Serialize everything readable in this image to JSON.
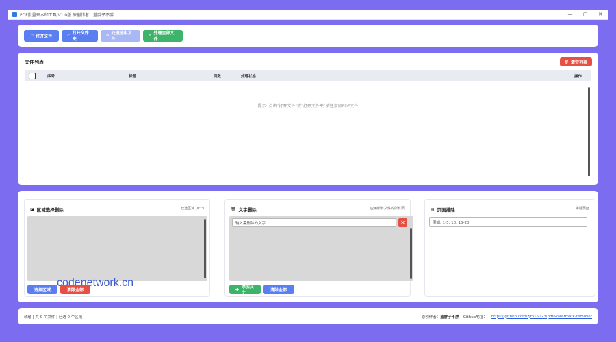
{
  "window": {
    "title": "PDF批量去水印工具 V1.0版   原创作者：蓝胖子不胖",
    "controls": {
      "minimize": "—",
      "maximize": "▢",
      "close": "✕"
    }
  },
  "toolbar": {
    "open_file": "打开文件",
    "open_folder": "打开文件夹",
    "process_selected": "处理选中文件",
    "process_all": "处理全部文件"
  },
  "file_list": {
    "title": "文件列表",
    "clear_button": "清空列表",
    "columns": {
      "no": "序号",
      "name": "标题",
      "pages": "页数",
      "status": "处理状态",
      "ops": "操作"
    },
    "empty_hint": "提示: 点击\"打开文件\"或\"打开文件夹\"按钮添加PDF文件"
  },
  "region_card": {
    "title": "区域选择删除",
    "hint": "已选区域 (0个)",
    "watermark": "codenetwork.cn",
    "select_button": "选择区域",
    "clear_button": "清除全部"
  },
  "text_card": {
    "title": "文字删除",
    "hint": "应用所有文件的所有页",
    "input_placeholder": "输入需删除的文字",
    "add_button": "添加文字",
    "clear_button": "清除全部"
  },
  "pages_card": {
    "title": "页面排除",
    "hint": "排除页面",
    "input_placeholder": "例如: 1-5, 10, 15-20"
  },
  "status_bar": {
    "status": "就绪 | 共 0 个文件 | 已选 0 个区域",
    "author_label": "原创作者：",
    "author": "蓝胖子不胖",
    "github_label": "Github地址：",
    "github_url": "https://github.com/zjm15023/pdf-watermark-remover"
  }
}
